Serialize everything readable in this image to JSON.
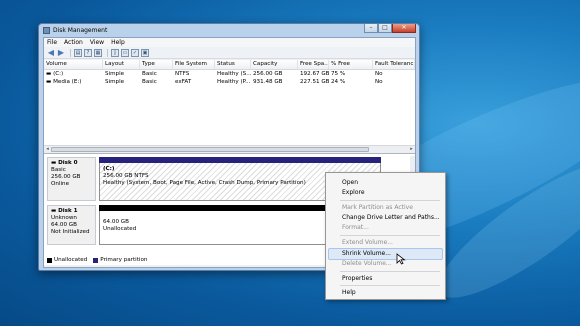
{
  "window": {
    "title": "Disk Management"
  },
  "menu": [
    "File",
    "Action",
    "View",
    "Help"
  ],
  "volume_list": {
    "columns": [
      "Volume",
      "Layout",
      "Type",
      "File System",
      "Status",
      "Capacity",
      "Free Spa...",
      "% Free",
      "Fault Toleranc"
    ],
    "rows": [
      [
        "(C:)",
        "Simple",
        "Basic",
        "NTFS",
        "Healthy (S...",
        "256.00 GB",
        "192.67 GB",
        "75 %",
        "No"
      ],
      [
        "Media (E:)",
        "Simple",
        "Basic",
        "exFAT",
        "Healthy (P...",
        "931.48 GB",
        "227.51 GB",
        "24 %",
        "No"
      ]
    ]
  },
  "disks": [
    {
      "name": "Disk 0",
      "kind": "Basic",
      "size": "256.00 GB",
      "state": "Online",
      "partition": {
        "label": "(C:)",
        "size_fs": "256.00 GB NTFS",
        "status": "Healthy (System, Boot, Page File, Active, Crash Dump, Primary Partition)"
      }
    },
    {
      "name": "Disk 1",
      "kind": "Unknown",
      "size": "64.00 GB",
      "state": "Not Initialized",
      "partition": {
        "size": "64.00 GB",
        "status": "Unallocated"
      }
    }
  ],
  "legend": {
    "unallocated": "Unallocated",
    "primary": "Primary partition"
  },
  "context_menu": [
    {
      "label": "Open",
      "enabled": true
    },
    {
      "label": "Explore",
      "enabled": true
    },
    {
      "label": "Mark Partition as Active",
      "enabled": false
    },
    {
      "label": "Change Drive Letter and Paths...",
      "enabled": true
    },
    {
      "label": "Format...",
      "enabled": false
    },
    {
      "label": "Extend Volume...",
      "enabled": false
    },
    {
      "label": "Shrink Volume...",
      "enabled": true,
      "highlighted": true
    },
    {
      "label": "Delete Volume...",
      "enabled": false
    },
    {
      "label": "Properties",
      "enabled": true
    },
    {
      "label": "Help",
      "enabled": true
    }
  ],
  "colors": {
    "primary_partition": "#25247a",
    "unallocated": "#000000",
    "menu_highlight": "#dde9f7"
  }
}
